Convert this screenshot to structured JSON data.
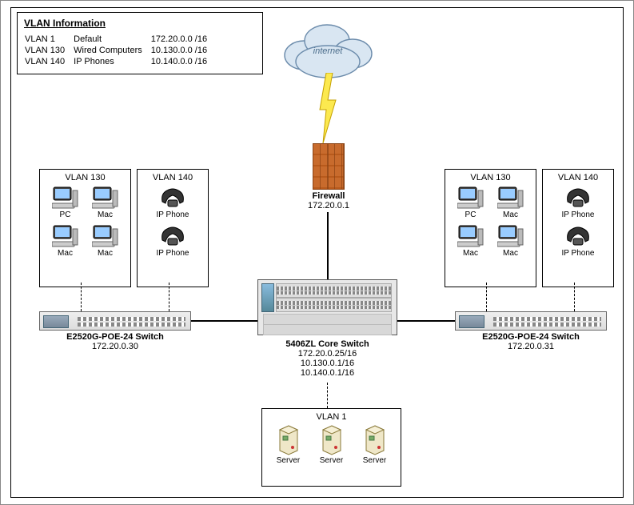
{
  "vlan_info": {
    "title": "VLAN Information",
    "rows": [
      {
        "id": "VLAN 1",
        "name": "Default",
        "subnet": "172.20.0.0 /16"
      },
      {
        "id": "VLAN 130",
        "name": "Wired Computers",
        "subnet": "10.130.0.0 /16"
      },
      {
        "id": "VLAN 140",
        "name": "IP Phones",
        "subnet": "10.140.0.0 /16"
      }
    ]
  },
  "internet": {
    "label": "iNTERNET"
  },
  "firewall": {
    "label": "Firewall",
    "ip": "172.20.0.1"
  },
  "core_switch": {
    "name": "5406ZL Core Switch",
    "ips": [
      "172.20.0.25/16",
      "10.130.0.1/16",
      "10.140.0.1/16"
    ]
  },
  "edge_switches": {
    "left": {
      "name": "E2520G-POE-24 Switch",
      "ip": "172.20.0.30"
    },
    "right": {
      "name": "E2520G-POE-24 Switch",
      "ip": "172.20.0.31"
    }
  },
  "groups": {
    "left_vlan130": {
      "title": "VLAN 130",
      "items": [
        {
          "label": "PC",
          "icon": "pc"
        },
        {
          "label": "Mac",
          "icon": "mac"
        },
        {
          "label": "Mac",
          "icon": "mac"
        },
        {
          "label": "Mac",
          "icon": "mac"
        }
      ]
    },
    "left_vlan140": {
      "title": "VLAN 140",
      "items": [
        {
          "label": "IP Phone",
          "icon": "phone"
        },
        {
          "label": "IP Phone",
          "icon": "phone"
        }
      ]
    },
    "right_vlan130": {
      "title": "VLAN 130",
      "items": [
        {
          "label": "PC",
          "icon": "pc"
        },
        {
          "label": "Mac",
          "icon": "mac"
        },
        {
          "label": "Mac",
          "icon": "mac"
        },
        {
          "label": "Mac",
          "icon": "mac"
        }
      ]
    },
    "right_vlan140": {
      "title": "VLAN 140",
      "items": [
        {
          "label": "IP Phone",
          "icon": "phone"
        },
        {
          "label": "IP Phone",
          "icon": "phone"
        }
      ]
    },
    "vlan1": {
      "title": "VLAN 1",
      "items": [
        {
          "label": "Server",
          "icon": "server"
        },
        {
          "label": "Server",
          "icon": "server"
        },
        {
          "label": "Server",
          "icon": "server"
        }
      ]
    }
  }
}
